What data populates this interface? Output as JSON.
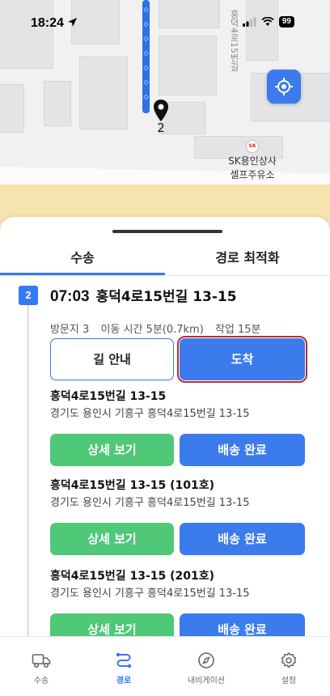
{
  "status_bar": {
    "time": "18:24",
    "battery": "99"
  },
  "map": {
    "street_label": "흥덕4로15번길",
    "pin_number": "2",
    "station_logo": "SK",
    "station_name_line1": "SK용인상사",
    "station_name_line2": "셀프주유소"
  },
  "tabs": [
    {
      "label": "수송"
    },
    {
      "label": "경로 최적화"
    }
  ],
  "stop": {
    "number": "2",
    "time": "07:03",
    "address": "흥덕4로15번길 13-15",
    "visit": "방문지 3",
    "travel": "이동 시간 5분(0.7km)",
    "work": "작업 15분",
    "guide_label": "길 안내",
    "arrive_label": "도착"
  },
  "items": [
    {
      "name": "흥덕4로15번길 13-15",
      "address": "경기도 용인시 기흥구 흥덕4로15번길 13-15",
      "detail_label": "상세 보기",
      "done_label": "배송 완료"
    },
    {
      "name": "흥덕4로15번길 13-15 (101호)",
      "address": "경기도 용인시 기흥구 흥덕4로15번길 13-15",
      "detail_label": "상세 보기",
      "done_label": "배송 완료"
    },
    {
      "name": "흥덕4로15번길 13-15 (201호)",
      "address": "경기도 용인시 기흥구 흥덕4로15번길 13-15",
      "detail_label": "상세 보기",
      "done_label": "배송 완료"
    }
  ],
  "bottom_nav": [
    {
      "label": "수송",
      "icon": "truck-icon"
    },
    {
      "label": "경로",
      "icon": "route-icon"
    },
    {
      "label": "내비게이션",
      "icon": "compass-icon"
    },
    {
      "label": "설정",
      "icon": "gear-icon"
    }
  ],
  "colors": {
    "primary": "#3478f6",
    "success": "#4fc878",
    "highlight": "#c0282c"
  }
}
